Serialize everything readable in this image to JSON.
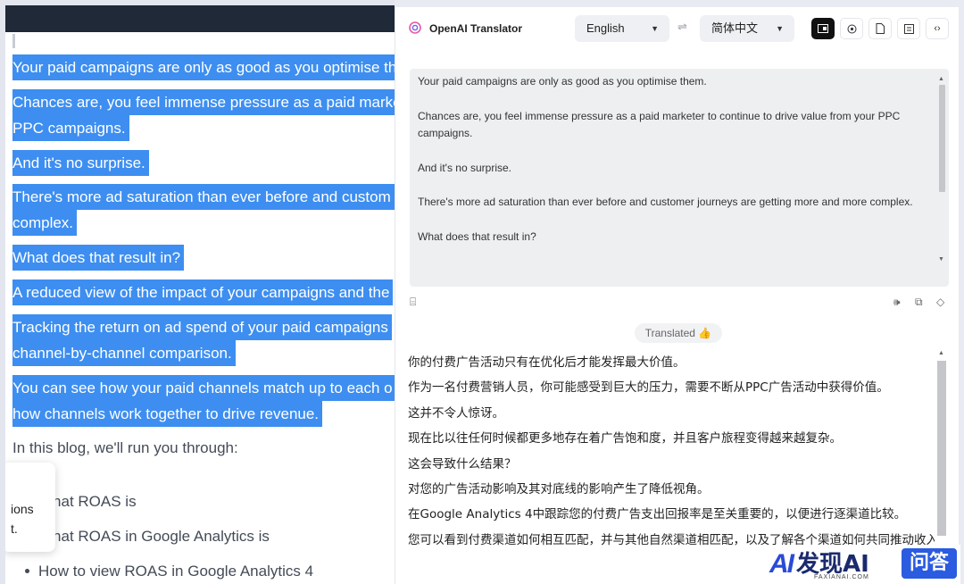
{
  "article": {
    "highlighted_lines": [
      "Your paid campaigns are only as good as you optimise th",
      "Chances are, you feel immense pressure as a paid marke",
      "PPC campaigns.",
      "And it's no surprise.",
      "There's more ad saturation than ever before and custom",
      "complex.",
      "What does that result in?",
      "A reduced view of the impact of your campaigns and the",
      "Tracking the return on ad spend of your paid campaigns",
      "channel-by-channel comparison.",
      "You can see how your paid channels match up to each o",
      "how channels work together to drive revenue."
    ],
    "intro": "In this blog, we'll run you through:",
    "bullets": [
      "What ROAS is",
      "What ROAS in Google Analytics is",
      "How to view ROAS in Google Analytics 4"
    ],
    "popup_text_1": "ions",
    "popup_text_2": "t."
  },
  "translator": {
    "app_title": "OpenAI Translator",
    "source_lang": "English",
    "target_lang": "简体中文",
    "source_paragraphs": [
      "Your paid campaigns are only as good as you optimise them.",
      "Chances are, you feel immense pressure as a paid marketer to continue to drive value from your PPC campaigns.",
      "And it's no surprise.",
      "There's more ad saturation than ever before and customer journeys are getting more and more complex.",
      "What does that result in?"
    ],
    "status_badge": "Translated 👍",
    "translated_lines": [
      "你的付费广告活动只有在优化后才能发挥最大价值。",
      "作为一名付费营销人员，你可能感受到巨大的压力，需要不断从PPC广告活动中获得价值。",
      "这并不令人惊讶。",
      "现在比以往任何时候都更多地存在着广告饱和度，并且客户旅程变得越来越复杂。",
      "这会导致什么结果？",
      "对您的广告活动影响及其对底线的影响产生了降低视角。",
      "在Google Analytics 4中跟踪您的付费广告支出回报率是至关重要的，以便进行逐渠道比较。",
      "您可以看到付费渠道如何相互匹配，并与其他自然渠道相匹配，以及了解各个渠道如何共同推动收入增长。"
    ]
  },
  "watermark": {
    "logo": "AI",
    "cn": "发现AI",
    "sub": "FAXIANAI.COM",
    "q": "问答"
  },
  "colors": {
    "highlight": "#3d8ef0",
    "active_button": "#111111",
    "watermark_blue": "#2a5be0"
  },
  "icons": [
    "openai-logo-icon",
    "swap-icon",
    "window-icon",
    "settings-icon",
    "document-icon",
    "note-icon",
    "code-icon",
    "keyboard-icon",
    "speaker-icon",
    "copy-icon",
    "eraser-icon"
  ]
}
